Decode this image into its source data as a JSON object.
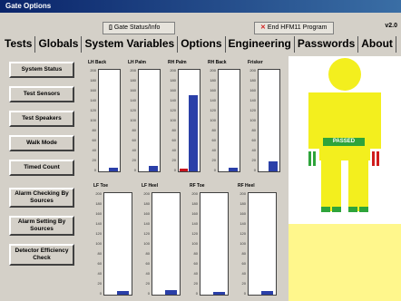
{
  "window": {
    "title": "Gate Options"
  },
  "toolbar": {
    "gate_status_label": "Gate Status/Info",
    "end_program_label": "End HFM11 Program",
    "version": "v2.0"
  },
  "tabs": [
    {
      "label": "Tests"
    },
    {
      "label": "Globals"
    },
    {
      "label": "System Variables"
    },
    {
      "label": "Options"
    },
    {
      "label": "Engineering"
    },
    {
      "label": "Passwords"
    },
    {
      "label": "About"
    }
  ],
  "side_buttons": [
    {
      "label": "System Status"
    },
    {
      "label": "Test Sensors"
    },
    {
      "label": "Test Speakers"
    },
    {
      "label": "Walk Mode"
    },
    {
      "label": "Timed Count"
    },
    {
      "label": "Alarm Checking By Sources"
    },
    {
      "label": "Alarm Setting By Sources"
    },
    {
      "label": "Detector Efficiency Check"
    }
  ],
  "gauges_top": [
    {
      "label": "LH Back",
      "value": 8,
      "red": 0
    },
    {
      "label": "LH Palm",
      "value": 10,
      "red": 0
    },
    {
      "label": "RH Palm",
      "value": 150,
      "red": 6
    },
    {
      "label": "RH Back",
      "value": 7,
      "red": 0
    },
    {
      "label": "Frisker",
      "value": 20,
      "red": 0
    }
  ],
  "gauges_bottom": [
    {
      "label": "LF Toe",
      "value": 7,
      "red": 0
    },
    {
      "label": "LF Heel",
      "value": 9,
      "red": 0
    },
    {
      "label": "RF Toe",
      "value": 6,
      "red": 0
    },
    {
      "label": "RF Heel",
      "value": 8,
      "red": 0
    }
  ],
  "tick_labels": [
    "200",
    "180",
    "160",
    "140",
    "120",
    "100",
    "80",
    "60",
    "40",
    "20",
    "0"
  ],
  "status": {
    "text": "PASSED"
  },
  "colors": {
    "bar_blue": "#2a3fa8",
    "bar_red": "#c8141e",
    "body_yellow": "#f3ef1e",
    "pass_green": "#2ea43b",
    "fail_red": "#d01c1c",
    "pane_yellow": "#fff78c"
  }
}
